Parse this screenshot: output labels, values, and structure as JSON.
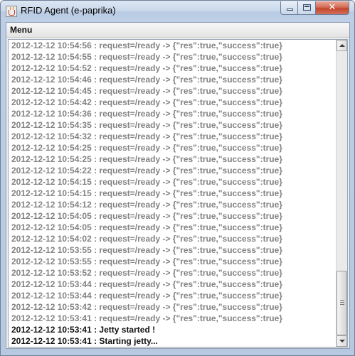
{
  "window": {
    "title": "RFID Agent (e-paprika)",
    "close_glyph": "✕",
    "title_icon": "java-cup-icon"
  },
  "menubar": {
    "menu_label": "Menu"
  },
  "log": {
    "lines": [
      {
        "text": "2012-12-12 10:54:56 : request=/ready -> {\"res\":true,\"success\":true}",
        "emphasis": false
      },
      {
        "text": "2012-12-12 10:54:55 : request=/ready -> {\"res\":true,\"success\":true}",
        "emphasis": false
      },
      {
        "text": "2012-12-12 10:54:52 : request=/ready -> {\"res\":true,\"success\":true}",
        "emphasis": false
      },
      {
        "text": "2012-12-12 10:54:46 : request=/ready -> {\"res\":true,\"success\":true}",
        "emphasis": false
      },
      {
        "text": "2012-12-12 10:54:45 : request=/ready -> {\"res\":true,\"success\":true}",
        "emphasis": false
      },
      {
        "text": "2012-12-12 10:54:42 : request=/ready -> {\"res\":true,\"success\":true}",
        "emphasis": false
      },
      {
        "text": "2012-12-12 10:54:36 : request=/ready -> {\"res\":true,\"success\":true}",
        "emphasis": false
      },
      {
        "text": "2012-12-12 10:54:35 : request=/ready -> {\"res\":true,\"success\":true}",
        "emphasis": false
      },
      {
        "text": "2012-12-12 10:54:32 : request=/ready -> {\"res\":true,\"success\":true}",
        "emphasis": false
      },
      {
        "text": "2012-12-12 10:54:25 : request=/ready -> {\"res\":true,\"success\":true}",
        "emphasis": false
      },
      {
        "text": "2012-12-12 10:54:25 : request=/ready -> {\"res\":true,\"success\":true}",
        "emphasis": false
      },
      {
        "text": "2012-12-12 10:54:22 : request=/ready -> {\"res\":true,\"success\":true}",
        "emphasis": false
      },
      {
        "text": "2012-12-12 10:54:15 : request=/ready -> {\"res\":true,\"success\":true}",
        "emphasis": false
      },
      {
        "text": "2012-12-12 10:54:15 : request=/ready -> {\"res\":true,\"success\":true}",
        "emphasis": false
      },
      {
        "text": "2012-12-12 10:54:12 : request=/ready -> {\"res\":true,\"success\":true}",
        "emphasis": false
      },
      {
        "text": "2012-12-12 10:54:05 : request=/ready -> {\"res\":true,\"success\":true}",
        "emphasis": false
      },
      {
        "text": "2012-12-12 10:54:05 : request=/ready -> {\"res\":true,\"success\":true}",
        "emphasis": false
      },
      {
        "text": "2012-12-12 10:54:02 : request=/ready -> {\"res\":true,\"success\":true}",
        "emphasis": false
      },
      {
        "text": "2012-12-12 10:53:55 : request=/ready -> {\"res\":true,\"success\":true}",
        "emphasis": false
      },
      {
        "text": "2012-12-12 10:53:55 : request=/ready -> {\"res\":true,\"success\":true}",
        "emphasis": false
      },
      {
        "text": "2012-12-12 10:53:52 : request=/ready -> {\"res\":true,\"success\":true}",
        "emphasis": false
      },
      {
        "text": "2012-12-12 10:53:44 : request=/ready -> {\"res\":true,\"success\":true}",
        "emphasis": false
      },
      {
        "text": "2012-12-12 10:53:44 : request=/ready -> {\"res\":true,\"success\":true}",
        "emphasis": false
      },
      {
        "text": "2012-12-12 10:53:42 : request=/ready -> {\"res\":true,\"success\":true}",
        "emphasis": false
      },
      {
        "text": "2012-12-12 10:53:41 : request=/ready -> {\"res\":true,\"success\":true}",
        "emphasis": false
      },
      {
        "text": "2012-12-12 10:53:41 : Jetty started !",
        "emphasis": true
      },
      {
        "text": "2012-12-12 10:53:41 : Starting jetty...",
        "emphasis": true
      }
    ]
  },
  "scrollbar": {
    "position_fraction": 1.0
  }
}
